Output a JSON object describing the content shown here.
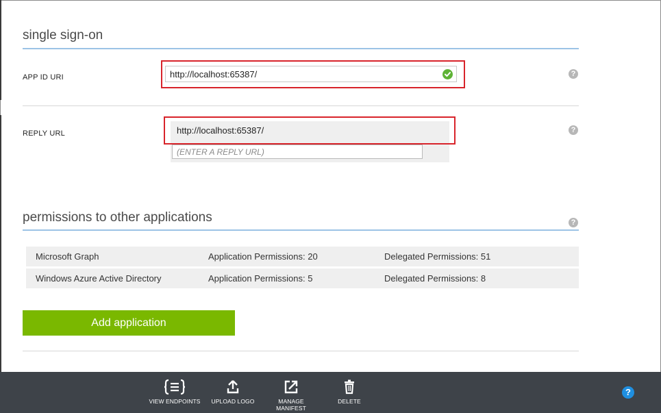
{
  "sso": {
    "title": "single sign-on",
    "app_id_label": "APP ID URI",
    "app_id_value": "http://localhost:65387/",
    "reply_label": "REPLY URL",
    "reply_value": "http://localhost:65387/",
    "reply_placeholder": "(ENTER A REPLY URL)",
    "help_glyph": "?"
  },
  "permissions": {
    "title": "permissions to other applications",
    "rows": [
      {
        "app": "Microsoft Graph",
        "application": "Application Permissions: 20",
        "delegated": "Delegated Permissions: 51"
      },
      {
        "app": "Windows Azure Active Directory",
        "application": "Application Permissions: 5",
        "delegated": "Delegated Permissions: 8"
      }
    ],
    "add_button": "Add application"
  },
  "bottom_bar": {
    "items": [
      {
        "label": "VIEW ENDPOINTS",
        "icon": "endpoints-icon"
      },
      {
        "label": "UPLOAD LOGO",
        "icon": "upload-icon"
      },
      {
        "label": "MANAGE MANIFEST",
        "icon": "manifest-icon"
      },
      {
        "label": "DELETE",
        "icon": "trash-icon"
      }
    ],
    "help_glyph": "?"
  },
  "colors": {
    "accent_green": "#7ab800",
    "section_line": "#9bc3e6",
    "highlight_red": "#d8232a",
    "bar_bg": "#3e4349",
    "help_blue": "#1f8fe0"
  }
}
